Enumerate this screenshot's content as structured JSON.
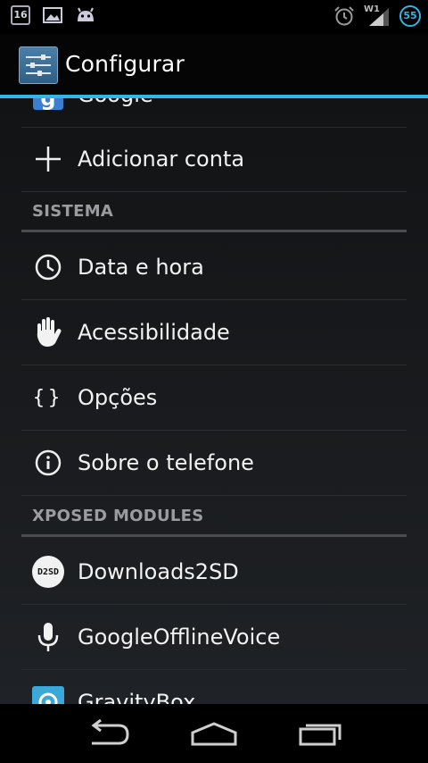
{
  "status_bar": {
    "calendar_day": "16",
    "wifi_label": "W1",
    "battery_level": "55",
    "icons": [
      "calendar-icon",
      "image-icon",
      "android-icon",
      "alarm-icon",
      "wifi-icon",
      "signal-icon",
      "battery-icon"
    ]
  },
  "action_bar": {
    "title": "Configurar",
    "icon": "settings-sliders-icon"
  },
  "list": {
    "partial_top_label": "Google",
    "add_account": "Adicionar conta",
    "section_system": "SISTEMA",
    "date_time": "Data e hora",
    "accessibility": "Acessibilidade",
    "options": "Opções",
    "about_phone": "Sobre o telefone",
    "section_xposed": "XPOSED MODULES",
    "downloads2sd": "Downloads2SD",
    "d2sd_badge": "D2SD",
    "google_offline_voice": "GoogleOfflineVoice",
    "gravitybox": "GravityBox"
  },
  "nav_bar": {
    "buttons": [
      "back-icon",
      "home-icon",
      "recent-apps-icon"
    ]
  },
  "colors": {
    "accent": "#33b5e5",
    "background": "#1a1c1f",
    "section_text": "#9a9c9f"
  }
}
